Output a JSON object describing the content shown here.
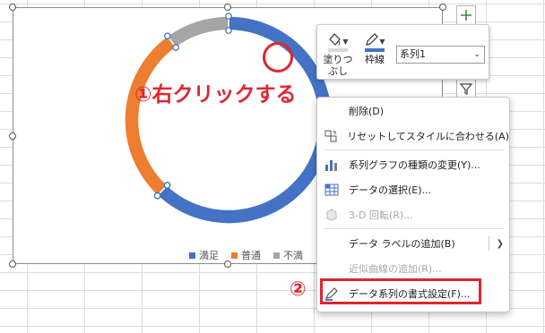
{
  "chart_data": {
    "type": "pie",
    "variant": "donut",
    "categories": [
      "満足",
      "普通",
      "不満"
    ],
    "values": [
      62,
      28,
      10
    ],
    "colors": [
      "#4472c4",
      "#ed7d31",
      "#a5a5a5"
    ],
    "legend_position": "bottom",
    "selected_series": "系列1"
  },
  "annotations": {
    "step1": "①右クリックする",
    "step2": "②"
  },
  "mini_toolbar": {
    "fill_label_line1": "塗りつ",
    "fill_label_line2": "ぶし",
    "outline_label": "枠線",
    "series_select_value": "系列1",
    "fill_color": "#d9d9d9",
    "outline_color": "#4472c4"
  },
  "context_menu": {
    "items": [
      {
        "label": "削除(D)",
        "icon": "delete-icon",
        "enabled": true
      },
      {
        "label": "リセットしてスタイルに合わせる(A)",
        "icon": "reset-style-icon",
        "enabled": true
      },
      {
        "label": "系列グラフの種類の変更(Y)...",
        "icon": "chart-type-icon",
        "enabled": true
      },
      {
        "label": "データの選択(E)...",
        "icon": "select-data-icon",
        "enabled": true
      },
      {
        "label": "3-D 回転(R)...",
        "icon": "rotate-3d-icon",
        "enabled": false
      },
      {
        "label": "データ ラベルの追加(B)",
        "icon": "",
        "enabled": true,
        "submenu": true
      },
      {
        "label": "近似曲線の追加(R)...",
        "icon": "",
        "enabled": false
      },
      {
        "label": "データ系列の書式設定(F)...",
        "icon": "format-series-icon",
        "enabled": true
      }
    ]
  }
}
